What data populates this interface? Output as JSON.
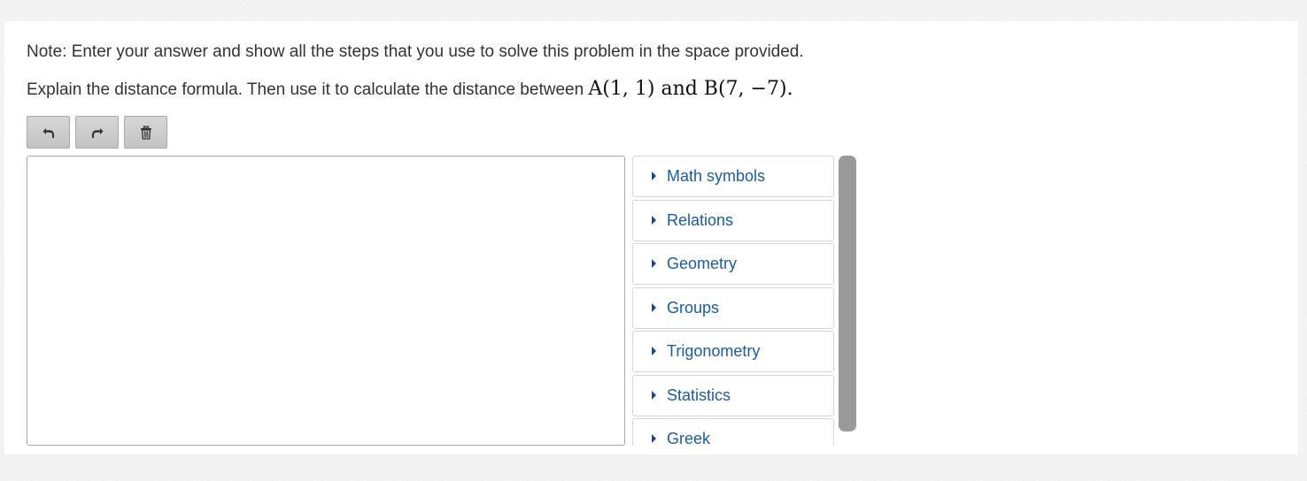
{
  "note": "Note: Enter your answer and show all the steps that you use to solve this problem in the space provided.",
  "question": {
    "text": "Explain the distance formula. Then use it to calculate the distance between ",
    "math": "A(1,  1) and B(7, −7)",
    "end": "."
  },
  "toolbar": {
    "buttons": [
      {
        "name": "undo-button",
        "icon": "undo-arrow-icon"
      },
      {
        "name": "redo-button",
        "icon": "redo-arrow-icon"
      },
      {
        "name": "clear-button",
        "icon": "trash-icon"
      }
    ]
  },
  "editor": {
    "value": ""
  },
  "palette": {
    "categories": [
      "Math symbols",
      "Relations",
      "Geometry",
      "Groups",
      "Trigonometry",
      "Statistics",
      "Greek"
    ]
  },
  "colors": {
    "link": "#1a5d9a",
    "caret": "#1a4a80",
    "scrollbar": "#9a9a9a",
    "button": "#cccccc"
  }
}
